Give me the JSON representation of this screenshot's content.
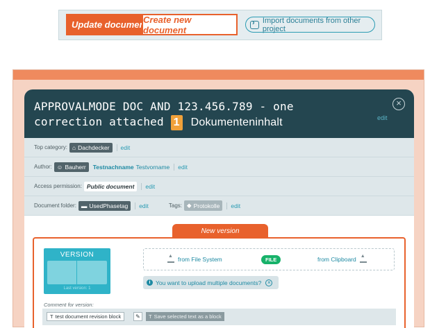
{
  "top_tabs": {
    "update_label": "Update document",
    "create_label": "Create new document",
    "import_label": "Import documents from other project"
  },
  "header": {
    "title_mono": "APPROVALMODE DOC AND 123.456.789 - one correction attached",
    "badge": "1",
    "title_suffix": "Dokumenteninhalt",
    "edit": "edit"
  },
  "rows": {
    "top_category": {
      "label": "Top category:",
      "value": "Dachdecker",
      "edit": "edit"
    },
    "author": {
      "label": "Author:",
      "role": "Bauherr",
      "last_name": "Testnachname",
      "first_name": "Testvorname",
      "edit": "edit"
    },
    "access": {
      "label": "Access permission:",
      "value": "Public document",
      "edit": "edit"
    },
    "folder": {
      "label": "Document folder:",
      "value": "UsedPhasetag",
      "edit": "edit",
      "tags_label": "Tags:",
      "tag_value": "Protokolle",
      "tags_edit": "edit"
    }
  },
  "new_version": {
    "tab_label": "New version",
    "version_label": "VERSION",
    "last_version": "Last version: 1",
    "from_file_system": "from File System",
    "file_badge": "FILE",
    "from_clipboard": "from Clipboard",
    "multi_upload": "You want to upload multiple documents?",
    "comment_label": "Comment for version:",
    "block_label": "test document revision block",
    "save_block": "Save selected text as a block"
  },
  "colors": {
    "accent_orange": "#e8612c",
    "header_dark": "#244650",
    "teal": "#2fb3c8",
    "file_green": "#17b26a"
  }
}
